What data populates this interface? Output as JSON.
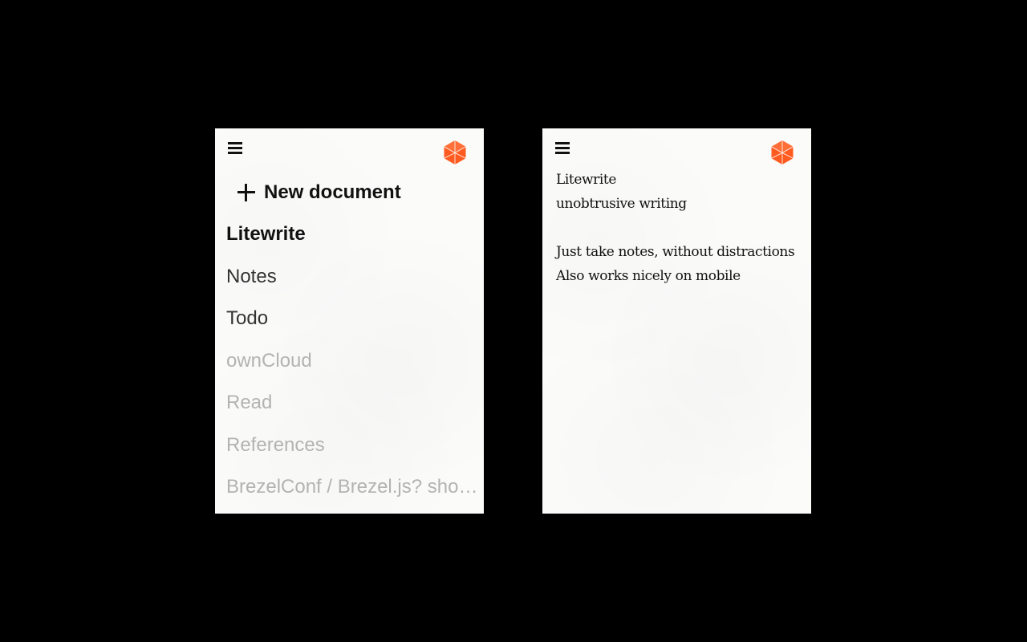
{
  "left_screen": {
    "new_document_label": "New document",
    "documents": [
      {
        "title": "Litewrite",
        "state": "active"
      },
      {
        "title": "Notes",
        "state": "recent"
      },
      {
        "title": "Todo",
        "state": "recent"
      },
      {
        "title": "ownCloud",
        "state": "faded"
      },
      {
        "title": "Read",
        "state": "faded"
      },
      {
        "title": "References",
        "state": "faded"
      },
      {
        "title": "BrezelConf / Brezel.js? should",
        "state": "faded"
      }
    ]
  },
  "right_screen": {
    "document_lines": [
      "Litewrite",
      "unobtrusive writing",
      "",
      "Just take notes, without distractions",
      "Also works nicely on mobile"
    ]
  },
  "icons": {
    "menu": "hamburger-menu-icon",
    "logo": "litewrite-cube-logo-icon"
  },
  "colors": {
    "background": "#000000",
    "paper": "#fbfbfa",
    "accent": "#ff5a1f",
    "text": "#111111",
    "muted_text": "#b3b3b3"
  }
}
